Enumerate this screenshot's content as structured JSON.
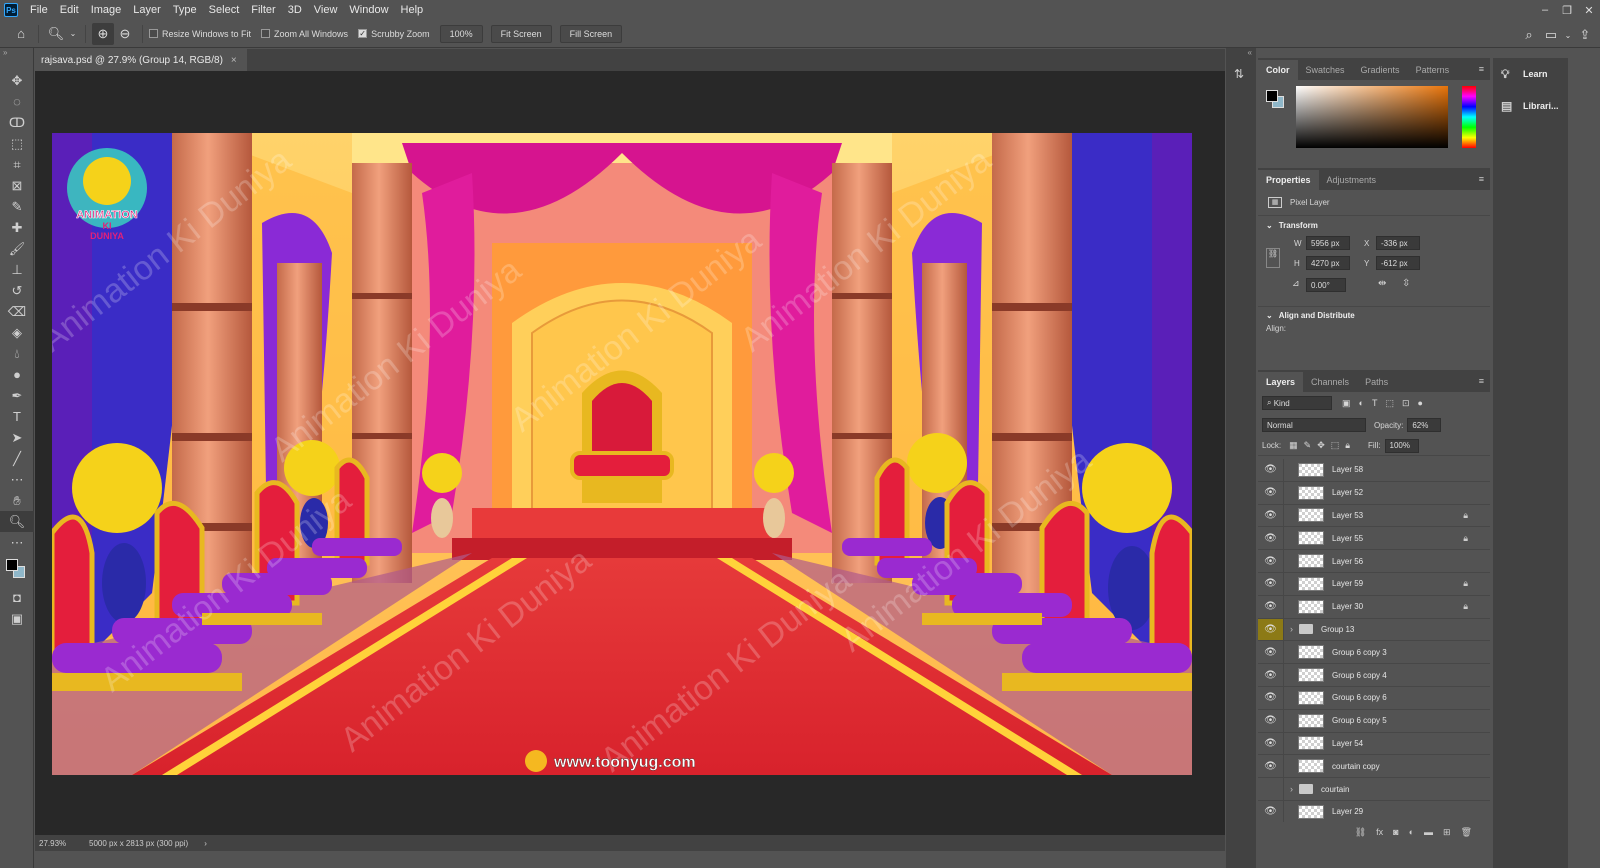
{
  "menubar": {
    "logo": "Ps",
    "items": [
      "File",
      "Edit",
      "Image",
      "Layer",
      "Type",
      "Select",
      "Filter",
      "3D",
      "View",
      "Window",
      "Help"
    ]
  },
  "options": {
    "resize_windows": "Resize Windows to Fit",
    "zoom_all": "Zoom All Windows",
    "scrubby_zoom": "Scrubby Zoom",
    "zoom_value": "100%",
    "fit_screen": "Fit Screen",
    "fill_screen": "Fill Screen"
  },
  "document": {
    "tab_title": "rajsava.psd @ 27.9% (Group 14, RGB/8)",
    "watermark_brand": "Animation Ki Duniya",
    "logo_line1": "ANIMATION",
    "logo_line2": "KI",
    "logo_line3": "DUNIYA",
    "website": "www.toonyug.com"
  },
  "status": {
    "zoom": "27.93%",
    "doc_info": "5000 px x 2813 px (300 ppi)"
  },
  "color_panel": {
    "tabs": [
      "Color",
      "Swatches",
      "Gradients",
      "Patterns"
    ]
  },
  "properties_panel": {
    "tabs": [
      "Properties",
      "Adjustments"
    ],
    "layer_type": "Pixel Layer",
    "transform_header": "Transform",
    "w_label": "W",
    "w_value": "5956 px",
    "x_label": "X",
    "x_value": "-336 px",
    "h_label": "H",
    "h_value": "4270 px",
    "y_label": "Y",
    "y_value": "-612 px",
    "angle_value": "0.00°",
    "align_header": "Align and Distribute",
    "align_label": "Align:"
  },
  "layers_panel": {
    "tabs": [
      "Layers",
      "Channels",
      "Paths"
    ],
    "filter_kind": "Kind",
    "blend_mode": "Normal",
    "opacity_label": "Opacity:",
    "opacity_value": "62%",
    "lock_label": "Lock:",
    "fill_label": "Fill:",
    "fill_value": "100%",
    "layers": [
      {
        "name": "Layer 58",
        "type": "pixel",
        "visible": true,
        "locked": false,
        "highlight": false
      },
      {
        "name": "Layer 52",
        "type": "pixel",
        "visible": true,
        "locked": false,
        "highlight": false
      },
      {
        "name": "Layer 53",
        "type": "pixel",
        "visible": true,
        "locked": true,
        "highlight": false
      },
      {
        "name": "Layer 55",
        "type": "pixel",
        "visible": true,
        "locked": true,
        "highlight": false
      },
      {
        "name": "Layer 56",
        "type": "pixel",
        "visible": true,
        "locked": false,
        "highlight": false
      },
      {
        "name": "Layer 59",
        "type": "pixel",
        "visible": true,
        "locked": true,
        "highlight": false
      },
      {
        "name": "Layer 30",
        "type": "pixel",
        "visible": true,
        "locked": true,
        "highlight": false
      },
      {
        "name": "Group 13",
        "type": "group",
        "visible": true,
        "locked": false,
        "highlight": true
      },
      {
        "name": "Group 6 copy 3",
        "type": "pixel",
        "visible": true,
        "locked": false,
        "highlight": false
      },
      {
        "name": "Group 6 copy 4",
        "type": "pixel",
        "visible": true,
        "locked": false,
        "highlight": false
      },
      {
        "name": "Group 6 copy 6",
        "type": "pixel",
        "visible": true,
        "locked": false,
        "highlight": false
      },
      {
        "name": "Group 6 copy 5",
        "type": "pixel",
        "visible": true,
        "locked": false,
        "highlight": false
      },
      {
        "name": "Layer 54",
        "type": "pixel",
        "visible": true,
        "locked": false,
        "highlight": false
      },
      {
        "name": "courtain copy",
        "type": "pixel",
        "visible": true,
        "locked": false,
        "highlight": false
      },
      {
        "name": "courtain",
        "type": "group",
        "visible": false,
        "locked": false,
        "highlight": false
      },
      {
        "name": "Layer 29",
        "type": "pixel",
        "visible": true,
        "locked": false,
        "highlight": false
      }
    ]
  },
  "learn_panel": {
    "learn": "Learn",
    "libraries": "Librari..."
  }
}
